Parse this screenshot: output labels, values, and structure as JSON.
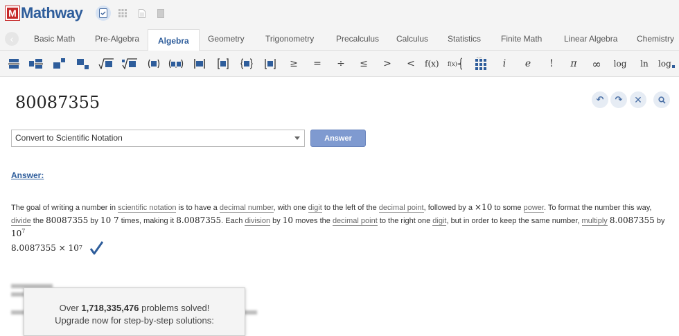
{
  "app": {
    "logo_letter": "M",
    "logo_name": "Mathway"
  },
  "modes": [
    {
      "name": "calculator-mode",
      "active": true
    },
    {
      "name": "grid-mode",
      "active": false
    },
    {
      "name": "document-mode",
      "active": false
    },
    {
      "name": "page-mode",
      "active": false
    }
  ],
  "tabs": [
    "Basic Math",
    "Pre-Algebra",
    "Algebra",
    "Geometry",
    "Trigonometry",
    "Precalculus",
    "Calculus",
    "Statistics",
    "Finite Math",
    "Linear Algebra",
    "Chemistry"
  ],
  "active_tab": "Algebra",
  "toolbar": {
    "symbols": [
      "≥",
      "=",
      "÷",
      "≤",
      ">",
      "<",
      "f(x)",
      "i",
      "e",
      "!",
      "π",
      "∞",
      "log",
      "ln",
      "log"
    ]
  },
  "problem": {
    "expression": "80087355"
  },
  "controls": {
    "undo": "undo",
    "redo": "redo",
    "clear": "clear",
    "search": "search"
  },
  "action": {
    "selected": "Convert to Scientific Notation",
    "button": "Answer"
  },
  "answer": {
    "heading": "Answer:",
    "text": {
      "p1": "The goal of writing a number in ",
      "k1": "scientific notation",
      "p2": " is to have a ",
      "k2": "decimal number",
      "p3": ", with one ",
      "k3": "digit",
      "p4": " to the left of the ",
      "k4": "decimal point",
      "p5": ", followed by a ",
      "m1": "×10",
      "p6": " to some ",
      "k5": "power",
      "p7": ". To format the number this way,",
      "k6": "divide",
      "p8": " the ",
      "m2": "80087355",
      "p9": " by ",
      "m3": "10 7",
      "p10": " times, making it ",
      "m4": "8.0087355",
      "p11": ". Each ",
      "k7": "division",
      "p12": " by ",
      "m5": "10",
      "p13": " moves the ",
      "k8": "decimal point",
      "p14": " to the right one ",
      "k9": "digit",
      "p15": ", but in order to keep the same number, ",
      "k10": "multiply",
      "p16": " ",
      "m6": "8.0087355",
      "p17": " by ",
      "m7base": "10",
      "m7exp": "7",
      "p18": "."
    },
    "result_mantissa": "8.0087355",
    "result_times": "×",
    "result_base": "10",
    "result_exp": "7"
  },
  "popup": {
    "line1_pre": "Over ",
    "count": "1,718,335,476",
    "line1_post": " problems solved!",
    "line2": "Upgrade now for step-by-step solutions:"
  },
  "colors": {
    "brand": "#2e5d9b",
    "button": "#7f9ad0",
    "check": "#2e5d9b"
  }
}
